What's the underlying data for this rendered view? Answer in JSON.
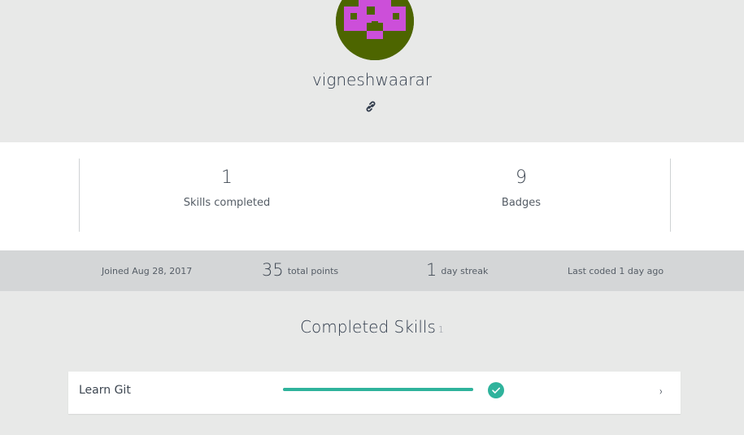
{
  "profile": {
    "username": "vigneshwaarar",
    "avatar_colors": {
      "background": "#4d6500",
      "foreground": "#cc4fd9"
    },
    "link_icon": "link-icon"
  },
  "stats": {
    "skills_completed": {
      "value": "1",
      "label": "Skills completed"
    },
    "badges": {
      "value": "9",
      "label": "Badges"
    }
  },
  "meta": {
    "joined": "Joined Aug 28, 2017",
    "points_value": "35",
    "points_label": "total points",
    "streak_value": "1",
    "streak_label": "day streak",
    "last_coded": "Last coded 1 day ago"
  },
  "completed_skills": {
    "title": "Completed Skills",
    "count": "1",
    "items": [
      {
        "name": "Learn Git",
        "progress": 1.0,
        "status_icon": "check-circle-icon",
        "chevron": "›"
      }
    ]
  },
  "colors": {
    "accent": "#2fb39c",
    "page_bg": "#e8e9e8",
    "strip_bg": "#d4d6d7"
  }
}
